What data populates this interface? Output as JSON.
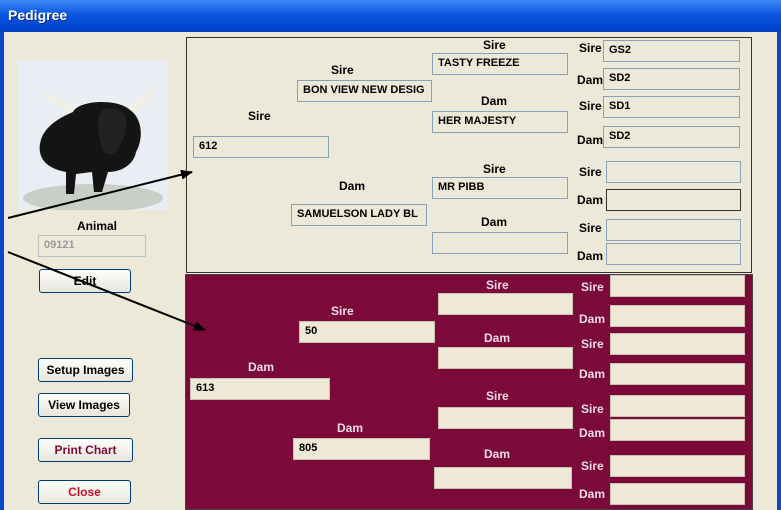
{
  "window": {
    "title": "Pedigree"
  },
  "left": {
    "animal_label": "Animal",
    "animal_id": "09121",
    "edit": "Edit",
    "setup_images": "Setup Images",
    "view_images": "View Images",
    "print_chart": "Print Chart",
    "close": "Close"
  },
  "sire_side": {
    "sire_label": "Sire",
    "sire": "612",
    "ss_label": "Sire",
    "ss": "BON VIEW NEW DESIG",
    "sd_label": "Dam",
    "sd": "SAMUELSON LADY BL",
    "sss_label": "Sire",
    "sss": "TASTY FREEZE",
    "ssd_label": "Dam",
    "ssd": "HER MAJESTY",
    "sds_label": "Sire",
    "sds": "MR PIBB",
    "sdd_label": "Dam",
    "sdd": "",
    "g4": [
      {
        "label": "Sire",
        "value": "GS2"
      },
      {
        "label": "Dam",
        "value": "SD2"
      },
      {
        "label": "Sire",
        "value": "SD1"
      },
      {
        "label": "Dam",
        "value": "SD2"
      },
      {
        "label": "Sire",
        "value": ""
      },
      {
        "label": "Dam",
        "value": ""
      },
      {
        "label": "Sire",
        "value": ""
      },
      {
        "label": "Dam",
        "value": ""
      }
    ]
  },
  "dam_side": {
    "dam_label": "Dam",
    "dam": "613",
    "ds_label": "Sire",
    "ds": "50",
    "dd_label": "Dam",
    "dd": "805",
    "dss_label": "Sire",
    "dss": "",
    "dsd_label": "Dam",
    "dsd": "",
    "dds_label": "Sire",
    "dds": "",
    "ddd_label": "Dam",
    "ddd": "",
    "g4": [
      {
        "label": "Sire",
        "value": ""
      },
      {
        "label": "Dam",
        "value": ""
      },
      {
        "label": "Sire",
        "value": ""
      },
      {
        "label": "Dam",
        "value": ""
      },
      {
        "label": "Sire",
        "value": ""
      },
      {
        "label": "Dam",
        "value": ""
      },
      {
        "label": "Sire",
        "value": ""
      },
      {
        "label": "Dam",
        "value": ""
      }
    ]
  }
}
